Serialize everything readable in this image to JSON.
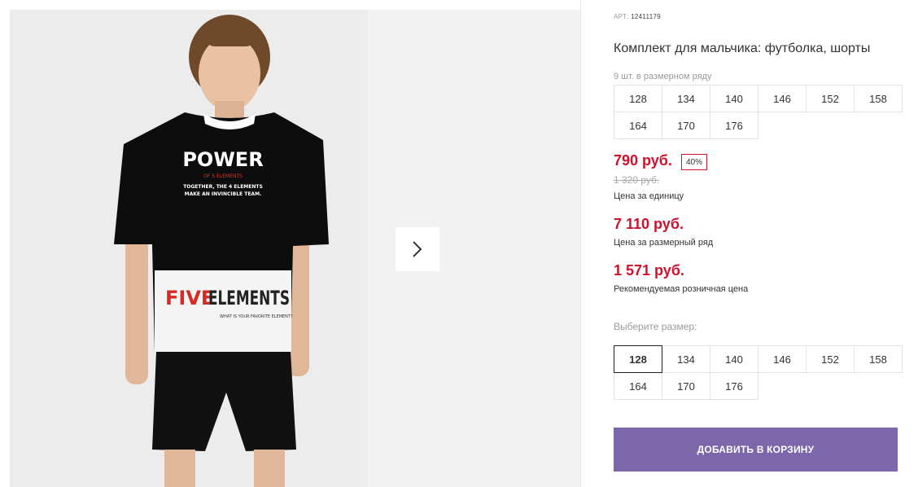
{
  "product": {
    "article_label": "АРТ:",
    "article_number": "12411179",
    "title": "Комплект для мальчика: футболка, шорты",
    "pack_info": "9 шт. в размерном ряду",
    "pack_sizes": [
      "128",
      "134",
      "140",
      "146",
      "152",
      "158",
      "164",
      "170",
      "176"
    ]
  },
  "prices": {
    "unit_price": "790 руб.",
    "discount_badge": "40%",
    "old_price": "1 320 руб.",
    "unit_price_label": "Цена за единицу",
    "pack_price": "7 110 руб.",
    "pack_price_label": "Цена за размерный ряд",
    "retail_price": "1 571 руб.",
    "retail_price_label": "Рекомендуемая розничная цена"
  },
  "size_picker": {
    "label": "Выберите размер:",
    "options": [
      "128",
      "134",
      "140",
      "146",
      "152",
      "158",
      "164",
      "170",
      "176"
    ],
    "selected": "128"
  },
  "cart_button_label": "ДОБАВИТЬ В КОРЗИНУ",
  "photo": {
    "tshirt_text_main": "POWER",
    "tshirt_text_sub": "OF 5 ELEMENTS",
    "tshirt_text_line1": "TOGETHER, THE 4 ELEMENTS",
    "tshirt_text_line2": "MAKE AN INVINCIBLE TEAM.",
    "tshirt_text_five": "FIVE",
    "tshirt_text_elements": "ELEMENTS",
    "tshirt_text_small": "WHAT IS YOUR FAVORITE ELEMENT?"
  },
  "icons": {
    "next": "chevron-right-icon"
  },
  "colors": {
    "price_red": "#d0112b",
    "cart_button": "#7b67a9"
  }
}
